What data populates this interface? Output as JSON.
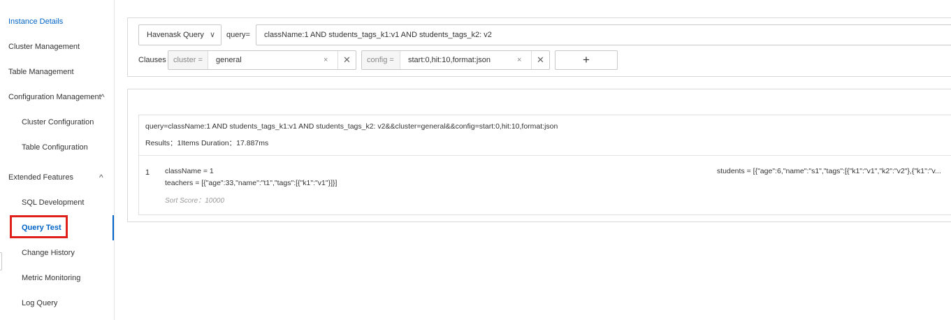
{
  "sidebar": {
    "items": [
      {
        "label": "Instance Details"
      },
      {
        "label": "Cluster Management"
      },
      {
        "label": "Table Management"
      },
      {
        "label": "Configuration Management"
      },
      {
        "label": "Cluster Configuration"
      },
      {
        "label": "Table Configuration"
      },
      {
        "label": "Extended Features"
      },
      {
        "label": "SQL Development"
      },
      {
        "label": "Query Test"
      },
      {
        "label": "Change History"
      },
      {
        "label": "Metric Monitoring"
      },
      {
        "label": "Log Query"
      }
    ],
    "chevrons": {
      "configuration": "^",
      "extended": "^"
    }
  },
  "query": {
    "type_select": "Havenask Query",
    "type_caret": "∨",
    "label": "query=",
    "value": "className:1 AND students_tags_k1:v1 AND students_tags_k2: v2"
  },
  "clauses": {
    "label": "Clauses",
    "items": [
      {
        "key": "cluster =",
        "value": "general",
        "clear": "×",
        "remove": "✕"
      },
      {
        "key": "config =",
        "value": "start:0,hit:10,format:json",
        "clear": "×",
        "remove": "✕"
      }
    ],
    "add_label": "+"
  },
  "results": {
    "query_string": "query=className:1 AND students_tags_k1:v1 AND students_tags_k2: v2&&cluster=general&&config=start:0,hit:10,format:json",
    "stats": "Results：1Items  Duration：17.887ms",
    "rows": [
      {
        "index": "1",
        "class_name": "className = 1",
        "teachers": "teachers = [{\"age\":33,\"name\":\"t1\",\"tags\":[{\"k1\":\"v1\"}]}]",
        "students": "students = [{\"age\":6,\"name\":\"s1\",\"tags\":[{\"k1\":\"v1\",\"k2\":\"v2\"},{\"k1\":\"v...",
        "sort_score": "Sort Score：10000"
      }
    ]
  },
  "colors": {
    "accent": "#0064c8",
    "highlight": "#e0201b"
  }
}
